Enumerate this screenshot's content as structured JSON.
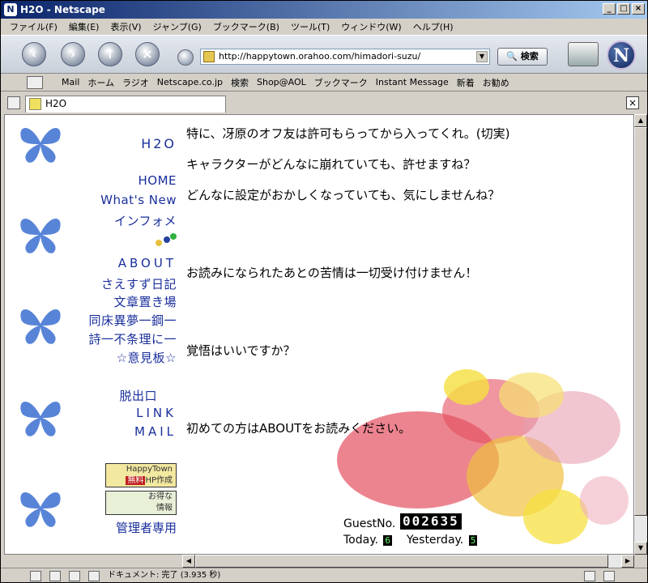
{
  "window": {
    "title": "H2O - Netscape"
  },
  "menu": [
    "ファイル(F)",
    "編集(E)",
    "表示(V)",
    "ジャンプ(G)",
    "ブックマーク(B)",
    "ツール(T)",
    "ウィンドウ(W)",
    "ヘルプ(H)"
  ],
  "nav": {
    "url": "http://happytown.orahoo.com/himadori-suzu/",
    "search_label": "検索"
  },
  "bookmarks": [
    "Mail",
    "ホーム",
    "ラジオ",
    "Netscape.co.jp",
    "検索",
    "Shop@AOL",
    "ブックマーク",
    "Instant Message",
    "新着",
    "お勧め"
  ],
  "tab": {
    "title": "H2O"
  },
  "site": {
    "title": "H2O",
    "links": {
      "home": "HOME",
      "whats_new": "What's New",
      "info": "インフォメ",
      "about": "ABOUT",
      "diary": "さえすず日記",
      "texts": "文章置き場",
      "dream": "同床異夢一鋼一",
      "poem": "詩一不条理に一",
      "board": "☆意見板☆",
      "exit": "脱出口",
      "link": "LINK",
      "mail": "MAIL",
      "admin": "管理者専用"
    },
    "badges": {
      "happytown_top": "HappyTown",
      "happytown_free": "無料",
      "happytown_hp": "HP作成",
      "deals_1": "お得な",
      "deals_2": "情報"
    },
    "messages": [
      "特に、冴原のオフ友は許可もらってから入ってくれ。(切実)",
      "キャラクターがどんなに崩れていても、許せますね？",
      "どんなに設定がおかしくなっていても、気にしませんね？",
      "お読みになられたあとの苦情は一切受け付けません！",
      "覚悟はいいですか？",
      "初めての方はABOUTをお読みください。"
    ],
    "counter": {
      "label": "GuestNo.",
      "value": "002635",
      "today_label": "Today.",
      "today_value": "6",
      "yesterday_label": "Yesterday.",
      "yesterday_value": "5"
    }
  },
  "status": {
    "text": "ドキュメント: 完了 (3.935 秒)"
  }
}
